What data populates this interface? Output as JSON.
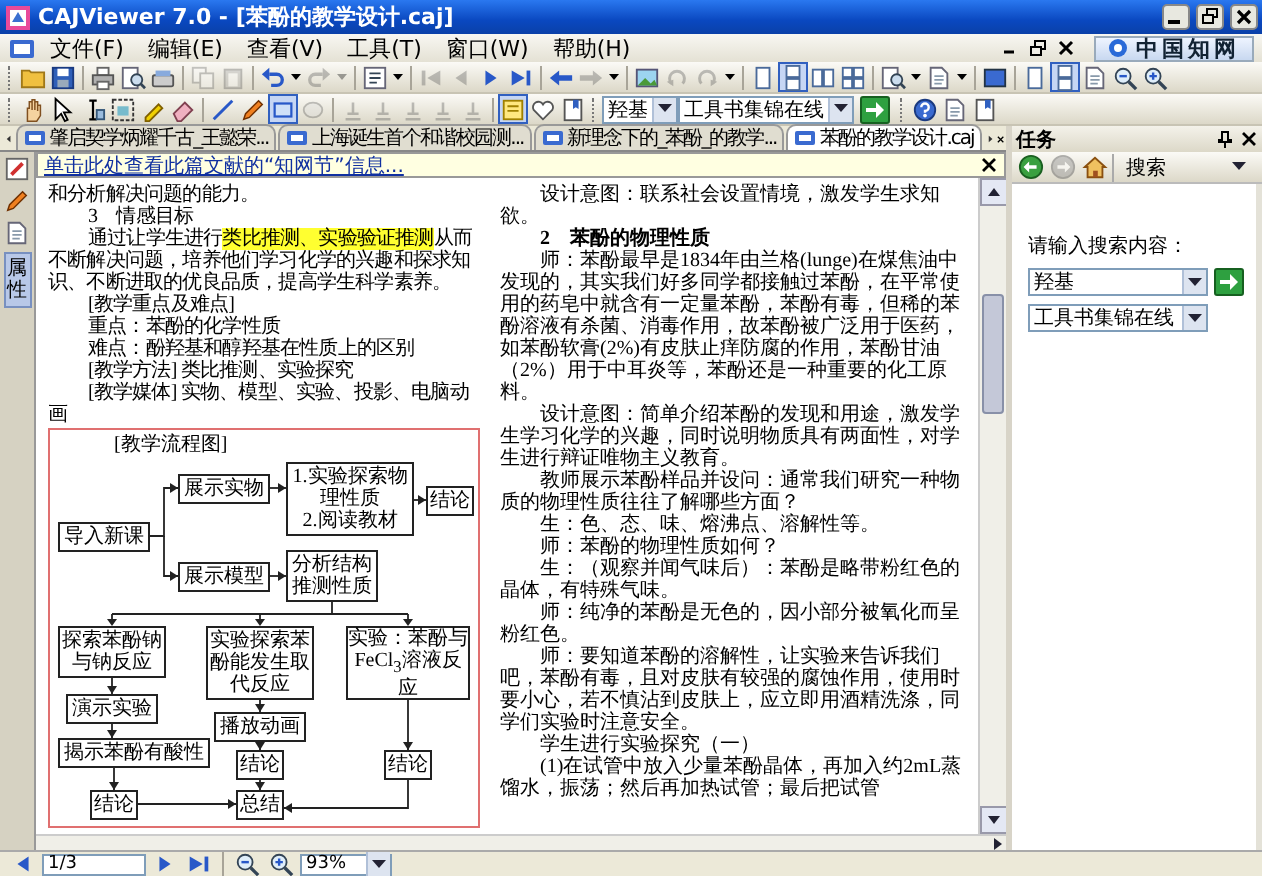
{
  "window": {
    "title": "CAJViewer 7.0 - [苯酚的教学设计.caj]"
  },
  "menu": [
    {
      "label": "文件(F)"
    },
    {
      "label": "编辑(E)"
    },
    {
      "label": "查看(V)"
    },
    {
      "label": "工具(T)"
    },
    {
      "label": "窗口(W)"
    },
    {
      "label": "帮助(H)"
    }
  ],
  "brand": {
    "label": "中国知网"
  },
  "toolbars": [
    {
      "groups": [
        [
          {
            "kind": "folder",
            "disabled": false,
            "pressed": false
          },
          {
            "kind": "disk",
            "disabled": false,
            "pressed": false
          }
        ],
        [
          {
            "kind": "printer",
            "disabled": false,
            "pressed": false
          },
          {
            "kind": "page-magnifier",
            "disabled": false,
            "pressed": false
          },
          {
            "kind": "scanner",
            "disabled": false,
            "pressed": false
          }
        ],
        [
          {
            "kind": "copy",
            "disabled": true,
            "pressed": false
          },
          {
            "kind": "clipboard",
            "disabled": true,
            "pressed": false
          }
        ],
        [
          {
            "kind": "undo-arrow",
            "disabled": false,
            "pressed": false
          },
          {
            "kind": "caret",
            "disabled": false,
            "pressed": false
          },
          {
            "kind": "redo-arrow",
            "disabled": true,
            "pressed": false
          },
          {
            "kind": "caret",
            "disabled": true,
            "pressed": false
          }
        ],
        [
          {
            "kind": "properties",
            "disabled": false,
            "pressed": false
          },
          {
            "kind": "caret",
            "disabled": false,
            "pressed": false
          }
        ],
        [
          {
            "kind": "first-page",
            "disabled": true,
            "pressed": false
          },
          {
            "kind": "previous",
            "disabled": true,
            "pressed": false
          },
          {
            "kind": "next",
            "disabled": false,
            "pressed": false
          },
          {
            "kind": "last-page",
            "disabled": false,
            "pressed": false
          }
        ],
        [
          {
            "kind": "back-arrow",
            "disabled": false,
            "pressed": false
          },
          {
            "kind": "forward-arrow",
            "disabled": true,
            "pressed": false
          },
          {
            "kind": "caret",
            "disabled": false,
            "pressed": false
          }
        ],
        [
          {
            "kind": "picture",
            "disabled": false,
            "pressed": false
          },
          {
            "kind": "rotate-left",
            "disabled": true,
            "pressed": false
          },
          {
            "kind": "rotate-right",
            "disabled": true,
            "pressed": false
          },
          {
            "kind": "caret",
            "disabled": false,
            "pressed": false
          }
        ],
        [
          {
            "kind": "single-page",
            "disabled": false,
            "pressed": false
          },
          {
            "kind": "continuous-pages",
            "disabled": false,
            "pressed": true
          },
          {
            "kind": "two-pages",
            "disabled": false,
            "pressed": false
          },
          {
            "kind": "four-pages",
            "disabled": false,
            "pressed": false
          }
        ],
        [
          {
            "kind": "page-magnifier",
            "disabled": false,
            "pressed": false
          },
          {
            "kind": "caret",
            "disabled": false,
            "pressed": false
          },
          {
            "kind": "document",
            "disabled": false,
            "pressed": false
          },
          {
            "kind": "caret",
            "disabled": false,
            "pressed": false
          }
        ],
        [
          {
            "kind": "fullscreen",
            "disabled": false,
            "pressed": false
          }
        ],
        [
          {
            "kind": "single-page",
            "disabled": false,
            "pressed": false
          },
          {
            "kind": "continuous-pages",
            "disabled": false,
            "pressed": true
          },
          {
            "kind": "document",
            "disabled": false,
            "pressed": false
          },
          {
            "kind": "zoom-out",
            "disabled": false,
            "pressed": false
          },
          {
            "kind": "zoom-in",
            "disabled": false,
            "pressed": false
          }
        ]
      ]
    },
    {
      "groups": [
        [
          {
            "kind": "hand",
            "disabled": false,
            "pressed": false
          },
          {
            "kind": "pointer",
            "disabled": false,
            "pressed": false
          },
          {
            "kind": "text-cursor",
            "disabled": false,
            "pressed": false
          },
          {
            "kind": "image-select",
            "disabled": false,
            "pressed": false
          },
          {
            "kind": "highlighter",
            "disabled": false,
            "pressed": false
          },
          {
            "kind": "eraser",
            "disabled": false,
            "pressed": false
          }
        ],
        [
          {
            "kind": "line",
            "disabled": false,
            "pressed": false
          },
          {
            "kind": "pencil",
            "disabled": false,
            "pressed": false
          },
          {
            "kind": "rectangle",
            "disabled": false,
            "pressed": true
          },
          {
            "kind": "ellipse",
            "disabled": true,
            "pressed": false
          }
        ],
        [
          {
            "kind": "stamp",
            "disabled": true,
            "pressed": false
          },
          {
            "kind": "stamp",
            "disabled": true,
            "pressed": false
          },
          {
            "kind": "stamp",
            "disabled": true,
            "pressed": false
          },
          {
            "kind": "stamp",
            "disabled": true,
            "pressed": false
          },
          {
            "kind": "stamp",
            "disabled": true,
            "pressed": false
          }
        ],
        [
          {
            "kind": "note",
            "disabled": false,
            "pressed": true
          },
          {
            "kind": "heart",
            "disabled": false,
            "pressed": false
          },
          {
            "kind": "bookmark",
            "disabled": false,
            "pressed": false
          }
        ]
      ],
      "search": {
        "query": "羟基",
        "source": "工具书集锦在线"
      },
      "tail": [
        {
          "kind": "help",
          "disabled": false,
          "pressed": false
        },
        {
          "kind": "document",
          "disabled": false,
          "pressed": false
        },
        {
          "kind": "bookmark",
          "disabled": false,
          "pressed": false
        }
      ]
    }
  ],
  "tabs": [
    {
      "label": "肇启契学炳耀千古_王懿荣...",
      "selected": false
    },
    {
      "label": "上海诞生首个和谐校园测...",
      "selected": false
    },
    {
      "label": "新理念下的_苯酚_的教学...",
      "selected": false
    },
    {
      "label": "苯酚的教学设计.caj",
      "selected": true
    }
  ],
  "side_tab": {
    "label": "属性"
  },
  "info_bar": {
    "text": "单击此处查看此篇文献的“知网节”信息..."
  },
  "document": {
    "left": [
      {
        "kind": "flush",
        "text": "和分析解决问题的能力。"
      },
      {
        "kind": "indent",
        "text": "3　情感目标"
      },
      {
        "kind": "indent",
        "segments": [
          {
            "text": "通过让学生进行",
            "highlighted": false
          },
          {
            "text": "类比推测、实验验证推测",
            "highlighted": true
          },
          {
            "text": "从而不断解决问题，培养他们学习化学的兴趣和探求知识、不断进取的优良品质，提高学生科学素养。",
            "highlighted": false
          }
        ]
      },
      {
        "kind": "indent",
        "text": "[教学重点及难点]"
      },
      {
        "kind": "indent",
        "text": "重点：苯酚的化学性质"
      },
      {
        "kind": "indent",
        "text": "难点：酚羟基和醇羟基在性质上的区别"
      },
      {
        "kind": "indent",
        "text": "[教学方法] 类比推测、实验探究"
      },
      {
        "kind": "indent",
        "text": "[教学媒体] 实物、模型、实验、投影、电脑动画"
      }
    ],
    "flowchart": {
      "title": "[教学流程图]",
      "nodes": [
        {
          "text": "导入新课"
        },
        {
          "text": "展示实物"
        },
        {
          "items": [
            "1.实验探索物理性质",
            "2.阅读教材"
          ]
        },
        {
          "text": "结论"
        },
        {
          "text": "展示模型"
        },
        {
          "text": "分析结构推测性质"
        },
        {
          "text": "探索苯酚钠与钠反应"
        },
        {
          "text": "实验探索苯酚能发生取代反应"
        },
        {
          "text": "实验：苯酚与FeCl$_{3}$溶液反应"
        },
        {
          "text": "演示实验"
        },
        {
          "text": "播放动画"
        },
        {
          "text": "揭示苯酚有酸性"
        },
        {
          "text": "结论"
        },
        {
          "text": "结论"
        },
        {
          "text": "结论"
        },
        {
          "text": "总结"
        }
      ]
    },
    "right": [
      {
        "kind": "indent",
        "text": "设计意图：联系社会设置情境，激发学生求知欲。"
      },
      {
        "kind": "heading",
        "text": "2　苯酚的物理性质"
      },
      {
        "kind": "indent",
        "text": "师：苯酚最早是1834年由兰格(lunge)在煤焦油中发现的，其实我们好多同学都接触过苯酚，在平常使用的药皂中就含有一定量苯酚，苯酚有毒，但稀的苯酚溶液有杀菌、消毒作用，故苯酚被广泛用于医药，如苯酚软膏(2%)有皮肤止痒防腐的作用，苯酚甘油（2%）用于中耳炎等，苯酚还是一种重要的化工原料。"
      },
      {
        "kind": "indent",
        "text": "设计意图：简单介绍苯酚的发现和用途，激发学生学习化学的兴趣，同时说明物质具有两面性，对学生进行辩证唯物主义教育。"
      },
      {
        "kind": "indent",
        "text": "教师展示苯酚样品并设问：通常我们研究一种物质的物理性质往往了解哪些方面？"
      },
      {
        "kind": "indent",
        "text": "生：色、态、味、熔沸点、溶解性等。"
      },
      {
        "kind": "indent",
        "text": "师：苯酚的物理性质如何？"
      },
      {
        "kind": "indent",
        "text": "生：（观察并闻气味后）：苯酚是略带粉红色的晶体，有特殊气味。"
      },
      {
        "kind": "indent",
        "text": "师：纯净的苯酚是无色的，因小部分被氧化而呈粉红色。"
      },
      {
        "kind": "indent",
        "text": "师：要知道苯酚的溶解性，让实验来告诉我们吧，苯酚有毒，且对皮肤有较强的腐蚀作用，使用时要小心，若不慎沾到皮肤上，应立即用酒精洗涤，同学们实验时注意安全。"
      },
      {
        "kind": "indent",
        "text": "学生进行实验探究（一）"
      },
      {
        "kind": "indent",
        "text": "(1)在试管中放入少量苯酚晶体，再加入约2mL蒸馏水，振荡；然后再加热试管；最后把试管"
      }
    ]
  },
  "task_panel": {
    "title": "任务",
    "nav": [
      {
        "kind": "back",
        "disabled": false
      },
      {
        "kind": "forward",
        "disabled": true
      },
      {
        "kind": "home",
        "disabled": false
      }
    ],
    "mode": "搜索",
    "prompt": "请输入搜索内容：",
    "query": "羟基",
    "source": "工具书集锦在线"
  },
  "status_bar": {
    "page": "1/3",
    "zoom": "93%"
  }
}
